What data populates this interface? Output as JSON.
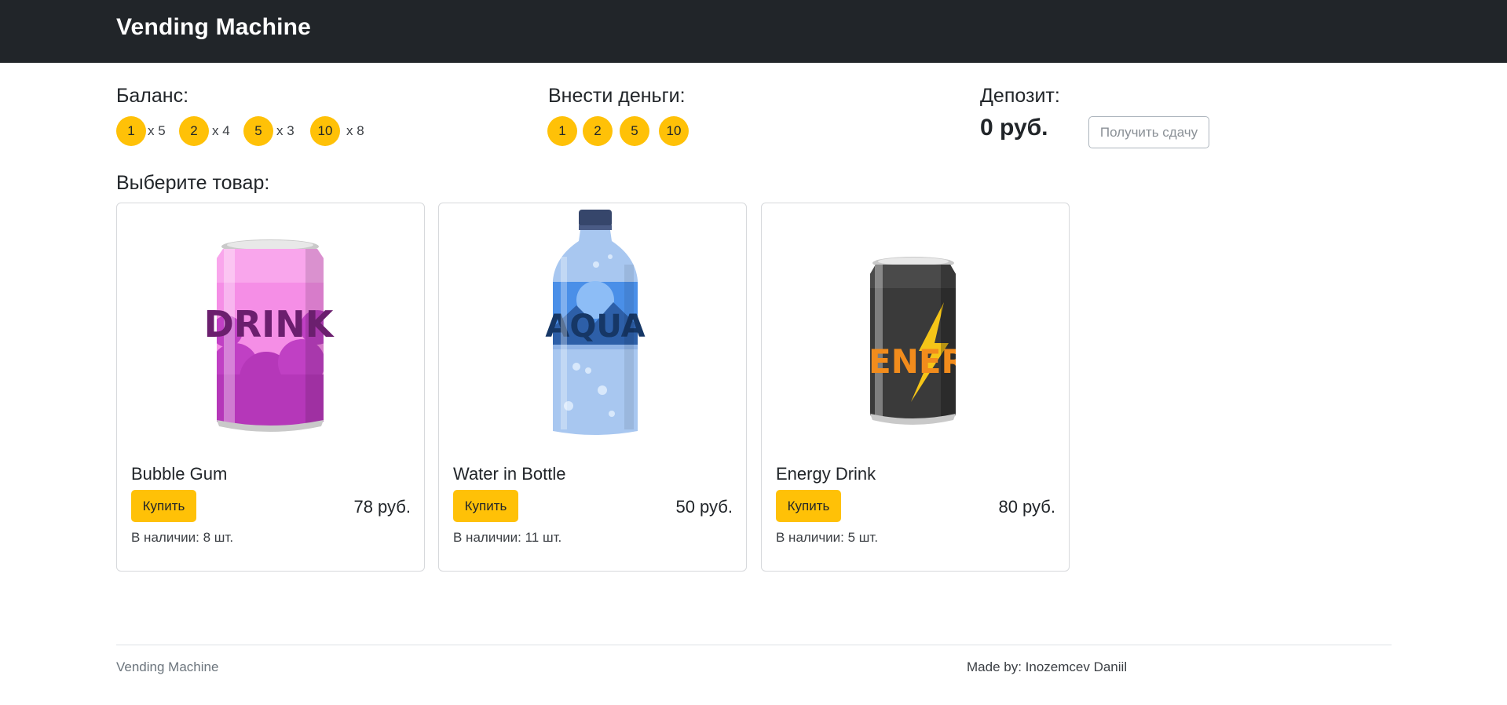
{
  "header": {
    "title": "Vending Machine"
  },
  "balance": {
    "title": "Баланс:",
    "coins": [
      {
        "value": "1",
        "count": "x 5"
      },
      {
        "value": "2",
        "count": "x 4"
      },
      {
        "value": "5",
        "count": "x 3"
      },
      {
        "value": "10",
        "count": "x 8"
      }
    ]
  },
  "insert": {
    "title": "Внести деньги:",
    "coins": [
      "1",
      "2",
      "5",
      "10"
    ]
  },
  "deposit": {
    "title": "Депозит:",
    "value": "0 руб.",
    "change_label": "Получить сдачу"
  },
  "catalog": {
    "title": "Выберите товар:",
    "products": [
      {
        "name": "Bubble Gum",
        "buy_label": "Купить",
        "price": "78 руб.",
        "stock": "В наличии: 8 шт.",
        "image_text": "DRINK",
        "icon": "pink-soda-can-icon"
      },
      {
        "name": "Water in Bottle",
        "buy_label": "Купить",
        "price": "50 руб.",
        "stock": "В наличии: 11 шт.",
        "image_text": "AQUA",
        "icon": "water-bottle-icon"
      },
      {
        "name": "Energy Drink",
        "buy_label": "Купить",
        "price": "80 руб.",
        "stock": "В наличии: 5 шт.",
        "image_text": "ENERG",
        "icon": "energy-drink-can-icon"
      }
    ]
  },
  "footer": {
    "left": "Vending Machine",
    "right": "Made by: Inozemcev Daniil"
  },
  "colors": {
    "accent": "#ffc107",
    "navbar": "#212529"
  }
}
